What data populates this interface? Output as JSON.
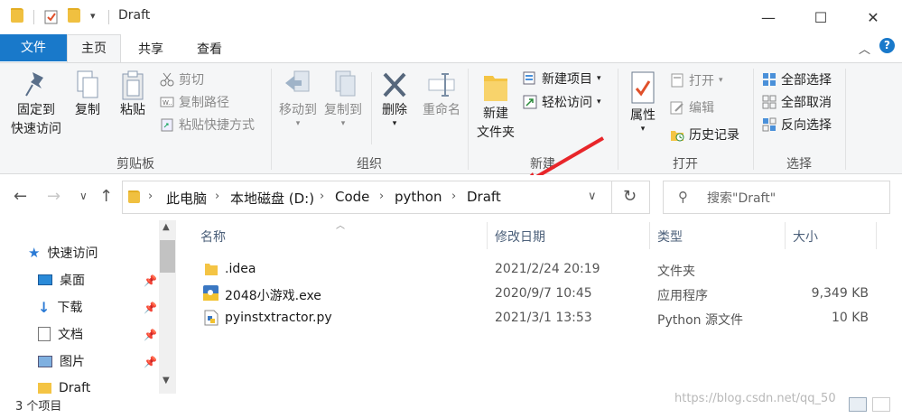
{
  "window": {
    "title": "Draft",
    "minimize_glyph": "—",
    "maximize_glyph": "☐",
    "close_glyph": "✕"
  },
  "ribbon_tabs": [
    {
      "label": "文件"
    },
    {
      "label": "主页"
    },
    {
      "label": "共享"
    },
    {
      "label": "查看"
    }
  ],
  "ribbon": {
    "clipboard": {
      "group_label": "剪贴板",
      "pin_quick_access": [
        "固定到",
        "快速访问"
      ],
      "copy": "复制",
      "paste": "粘贴",
      "cut": "剪切",
      "copy_path": "复制路径",
      "paste_shortcut": "粘贴快捷方式"
    },
    "organize": {
      "group_label": "组织",
      "move_to": "移动到",
      "copy_to": "复制到",
      "delete": "删除",
      "rename": "重命名"
    },
    "new": {
      "group_label": "新建",
      "new_folder": [
        "新建",
        "文件夹"
      ],
      "new_item": "新建项目",
      "easy_access": "轻松访问"
    },
    "open": {
      "group_label": "打开",
      "properties": "属性",
      "open": "打开",
      "edit": "编辑",
      "history": "历史记录"
    },
    "select": {
      "group_label": "选择",
      "select_all": "全部选择",
      "select_none": "全部取消",
      "invert_selection": "反向选择"
    }
  },
  "address": {
    "breadcrumbs": [
      "此电脑",
      "本地磁盘 (D:)",
      "Code",
      "python",
      "Draft"
    ]
  },
  "search": {
    "placeholder": "搜索\"Draft\""
  },
  "nav_pane": {
    "items": [
      {
        "label": "快速访问",
        "icon": "star-icon"
      },
      {
        "label": "桌面",
        "icon": "desktop-icon",
        "pinned": true
      },
      {
        "label": "下载",
        "icon": "download-icon",
        "pinned": true
      },
      {
        "label": "文档",
        "icon": "document-icon",
        "pinned": true
      },
      {
        "label": "图片",
        "icon": "picture-icon",
        "pinned": true
      },
      {
        "label": "Draft",
        "icon": "folder-icon"
      }
    ]
  },
  "file_list": {
    "columns": [
      "名称",
      "修改日期",
      "类型",
      "大小"
    ],
    "rows": [
      {
        "name": ".idea",
        "modified": "2021/2/24 20:19",
        "type": "文件夹",
        "size": "",
        "icon": "folder-icon"
      },
      {
        "name": "2048小游戏.exe",
        "modified": "2020/9/7 10:45",
        "type": "应用程序",
        "size": "9,349 KB",
        "icon": "exe-icon"
      },
      {
        "name": "pyinstxtractor.py",
        "modified": "2021/3/1 13:53",
        "type": "Python 源文件",
        "size": "10 KB",
        "icon": "python-file-icon"
      }
    ]
  },
  "status_bar": {
    "item_count": "3 个项目"
  },
  "watermark": "https://blog.csdn.net/qq_50"
}
